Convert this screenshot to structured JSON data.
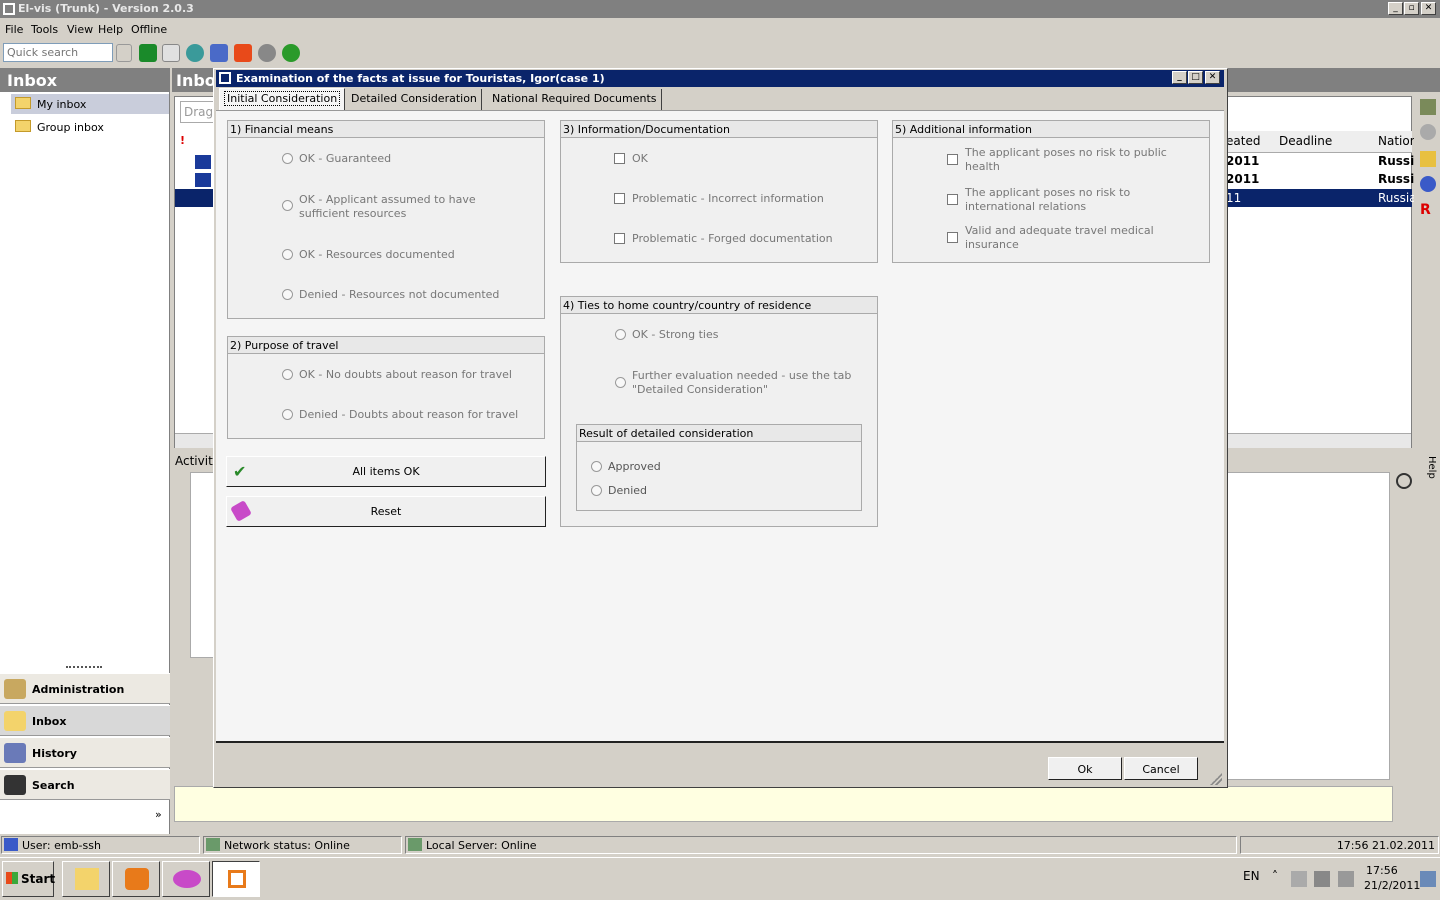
{
  "app": {
    "title": "El-vis (Trunk) - Version 2.0.3"
  },
  "menu": [
    "File",
    "Tools",
    "View",
    "Help",
    "Offline"
  ],
  "quick_search_placeholder": "Quick search",
  "sidebar": {
    "header": "Inbox",
    "tree": [
      {
        "label": "My inbox"
      },
      {
        "label": "Group inbox"
      }
    ],
    "nav": [
      {
        "label": "Administration"
      },
      {
        "label": "Inbox"
      },
      {
        "label": "History"
      },
      {
        "label": "Search"
      }
    ]
  },
  "main": {
    "header": "Inbo",
    "drag_hint": "Drag",
    "col_created": "eated",
    "col_deadline": "Deadline",
    "col_nation": "Nation",
    "rows": [
      {
        "created": "2011",
        "nation": "Russi"
      },
      {
        "created": "2011",
        "nation": "Russi"
      },
      {
        "created": "11",
        "nation": "Russia"
      }
    ],
    "activities_label": "Activiti",
    "help_label": "Help"
  },
  "dialog": {
    "title": "Examination of the facts at issue for Touristas, Igor(case 1)",
    "tabs": [
      "Initial Consideration",
      "Detailed Consideration",
      "National Required Documents"
    ],
    "financial": {
      "title": "1) Financial means",
      "options": [
        "OK - Guaranteed",
        "OK - Applicant assumed to have sufficient resources",
        "OK - Resources documented",
        "Denied - Resources not documented"
      ]
    },
    "purpose": {
      "title": "2) Purpose of travel",
      "options": [
        "OK - No doubts about reason for travel",
        "Denied - Doubts about reason for travel"
      ]
    },
    "info": {
      "title": "3) Information/Documentation",
      "options": [
        "OK",
        "Problematic - Incorrect information",
        "Problematic - Forged documentation"
      ]
    },
    "ties": {
      "title": "4) Ties to home country/country of residence",
      "options": [
        "OK - Strong ties",
        "Further evaluation needed - use the tab \"Detailed Consideration\""
      ],
      "result": {
        "title": "Result of detailed consideration",
        "options": [
          "Approved",
          "Denied"
        ]
      }
    },
    "additional": {
      "title": "5) Additional information",
      "options": [
        "The applicant poses no risk to public health",
        "The applicant poses no risk to international relations",
        "Valid and adequate travel medical insurance"
      ]
    },
    "all_ok_label": "All items OK",
    "reset_label": "Reset",
    "ok_label": "Ok",
    "cancel_label": "Cancel"
  },
  "status": {
    "user": "User: emb-ssh",
    "network": "Network status: Online",
    "local": "Local Server:  Online",
    "datetime": "17:56 21.02.2011"
  },
  "taskbar": {
    "start": "Start",
    "lang": "EN",
    "time": "17:56",
    "date": "21/2/2011"
  }
}
